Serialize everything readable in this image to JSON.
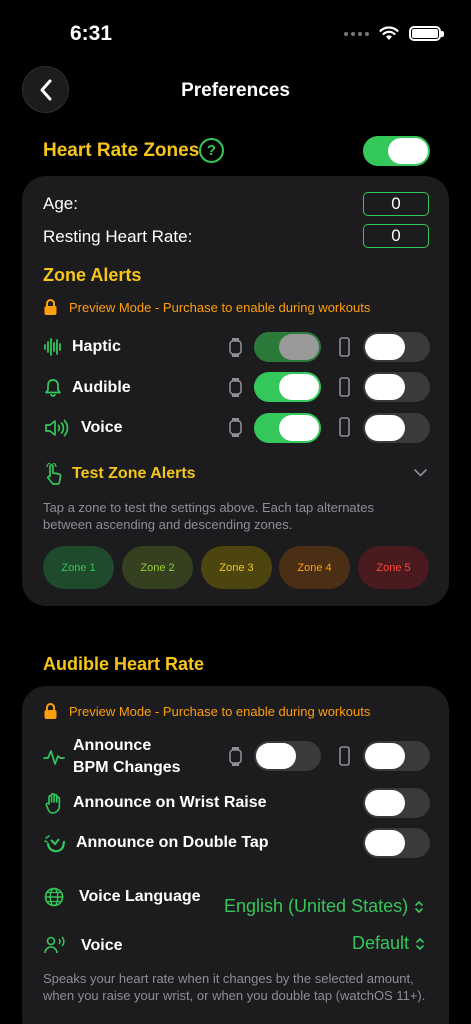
{
  "status": {
    "time": "6:31"
  },
  "nav": {
    "title": "Preferences"
  },
  "hr_zones": {
    "title": "Heart Rate Zones",
    "enabled": true,
    "age_label": "Age:",
    "age_value": "0",
    "resting_label": "Resting Heart Rate:",
    "resting_value": "0",
    "zone_alerts_title": "Zone Alerts",
    "preview_text": "Preview Mode - Purchase to enable during workouts",
    "alerts": [
      {
        "label": "Haptic",
        "icon": "waveform-icon",
        "watch": "dim",
        "phone": "off"
      },
      {
        "label": "Audible",
        "icon": "bell-icon",
        "watch": "on",
        "phone": "off"
      },
      {
        "label": "Voice",
        "icon": "speaker-icon",
        "watch": "on",
        "phone": "off"
      }
    ],
    "test_title": "Test Zone Alerts",
    "test_hint": "Tap a zone to test the settings above. Each tap alternates between ascending and descending zones.",
    "zones": [
      {
        "label": "Zone 1",
        "bg": "#1f4a2b",
        "fg": "#34c759"
      },
      {
        "label": "Zone 2",
        "bg": "#34401f",
        "fg": "#9acd32"
      },
      {
        "label": "Zone 3",
        "bg": "#4d4510",
        "fg": "#f5c518"
      },
      {
        "label": "Zone 4",
        "bg": "#4a2f14",
        "fg": "#ff9f0a"
      },
      {
        "label": "Zone 5",
        "bg": "#4a1a1e",
        "fg": "#ff453a"
      }
    ]
  },
  "audible_hr": {
    "title": "Audible Heart Rate",
    "preview_text": "Preview Mode - Purchase to enable during workouts",
    "announce_bpm_line1": "Announce",
    "announce_bpm_line2": "BPM Changes",
    "announce_wrist": "Announce on Wrist Raise",
    "announce_double_tap": "Announce on Double Tap",
    "voice_language_label": "Voice Language",
    "voice_language_value": "English (United States)",
    "voice_label": "Voice",
    "voice_value": "Default",
    "hint": "Speaks your heart rate when it changes by the selected amount, when you raise your wrist, or when you double tap (watchOS 11+)."
  },
  "colors": {
    "accent": "#34c759",
    "title": "#f5c518",
    "warning": "#ff9f0a",
    "card": "#1c1c1e"
  }
}
